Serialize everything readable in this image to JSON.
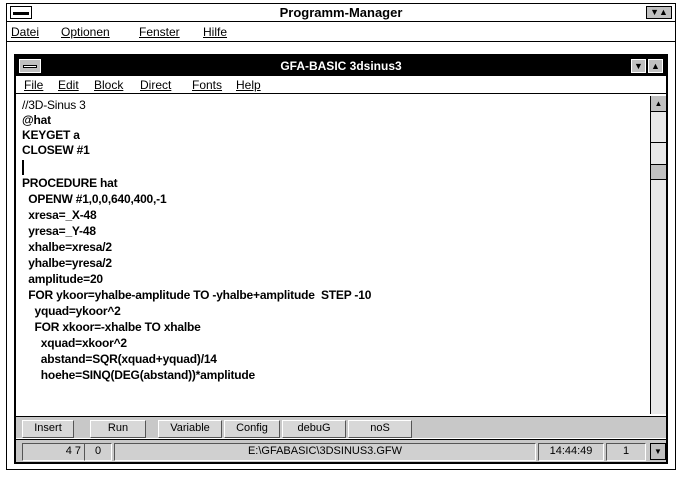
{
  "program_manager": {
    "title": "Programm-Manager",
    "buttons_glyph": "▼▲",
    "menu": [
      {
        "label": "Datei"
      },
      {
        "label": "Optionen"
      },
      {
        "label": "Fenster"
      },
      {
        "label": "Hilfe"
      }
    ]
  },
  "gfa_window": {
    "title": "GFA-BASIC  3dsinus3",
    "min_glyph": "▼",
    "max_glyph": "▲",
    "menu": [
      {
        "label": "File"
      },
      {
        "label": "Edit"
      },
      {
        "label": "Block"
      },
      {
        "label": "Direct"
      },
      {
        "label": "Fonts"
      },
      {
        "label": "Help"
      }
    ],
    "code_lines": [
      "//3D-Sinus 3",
      "@hat",
      "KEYGET a",
      "CLOSEW #1",
      "",
      "PROCEDURE hat",
      "  OPENW #1,0,0,640,400,-1",
      "  xresa=_X-48",
      "  yresa=_Y-48",
      "  xhalbe=xresa/2",
      "  yhalbe=yresa/2",
      "  amplitude=20",
      "  FOR ykoor=yhalbe-amplitude TO -yhalbe+amplitude  STEP -10",
      "    yquad=ykoor^2",
      "    FOR xkoor=-xhalbe TO xhalbe",
      "      xquad=xkoor^2",
      "      abstand=SQR(xquad+yquad)/14",
      "      hoehe=SINQ(DEG(abstand))*amplitude"
    ],
    "scroll_up_glyph": "▲",
    "scroll_down_glyph": "▼",
    "toolbar": [
      {
        "label": "Insert"
      },
      {
        "label": "Run"
      },
      {
        "label": "Variable"
      },
      {
        "label": "Config"
      },
      {
        "label": "debuG"
      },
      {
        "label": "noS"
      }
    ],
    "status": {
      "line": "4 7",
      "col": "0",
      "path": "E:\\GFABASIC\\3DSINUS3.GFW",
      "time": "14:44:49",
      "page": "1"
    }
  }
}
